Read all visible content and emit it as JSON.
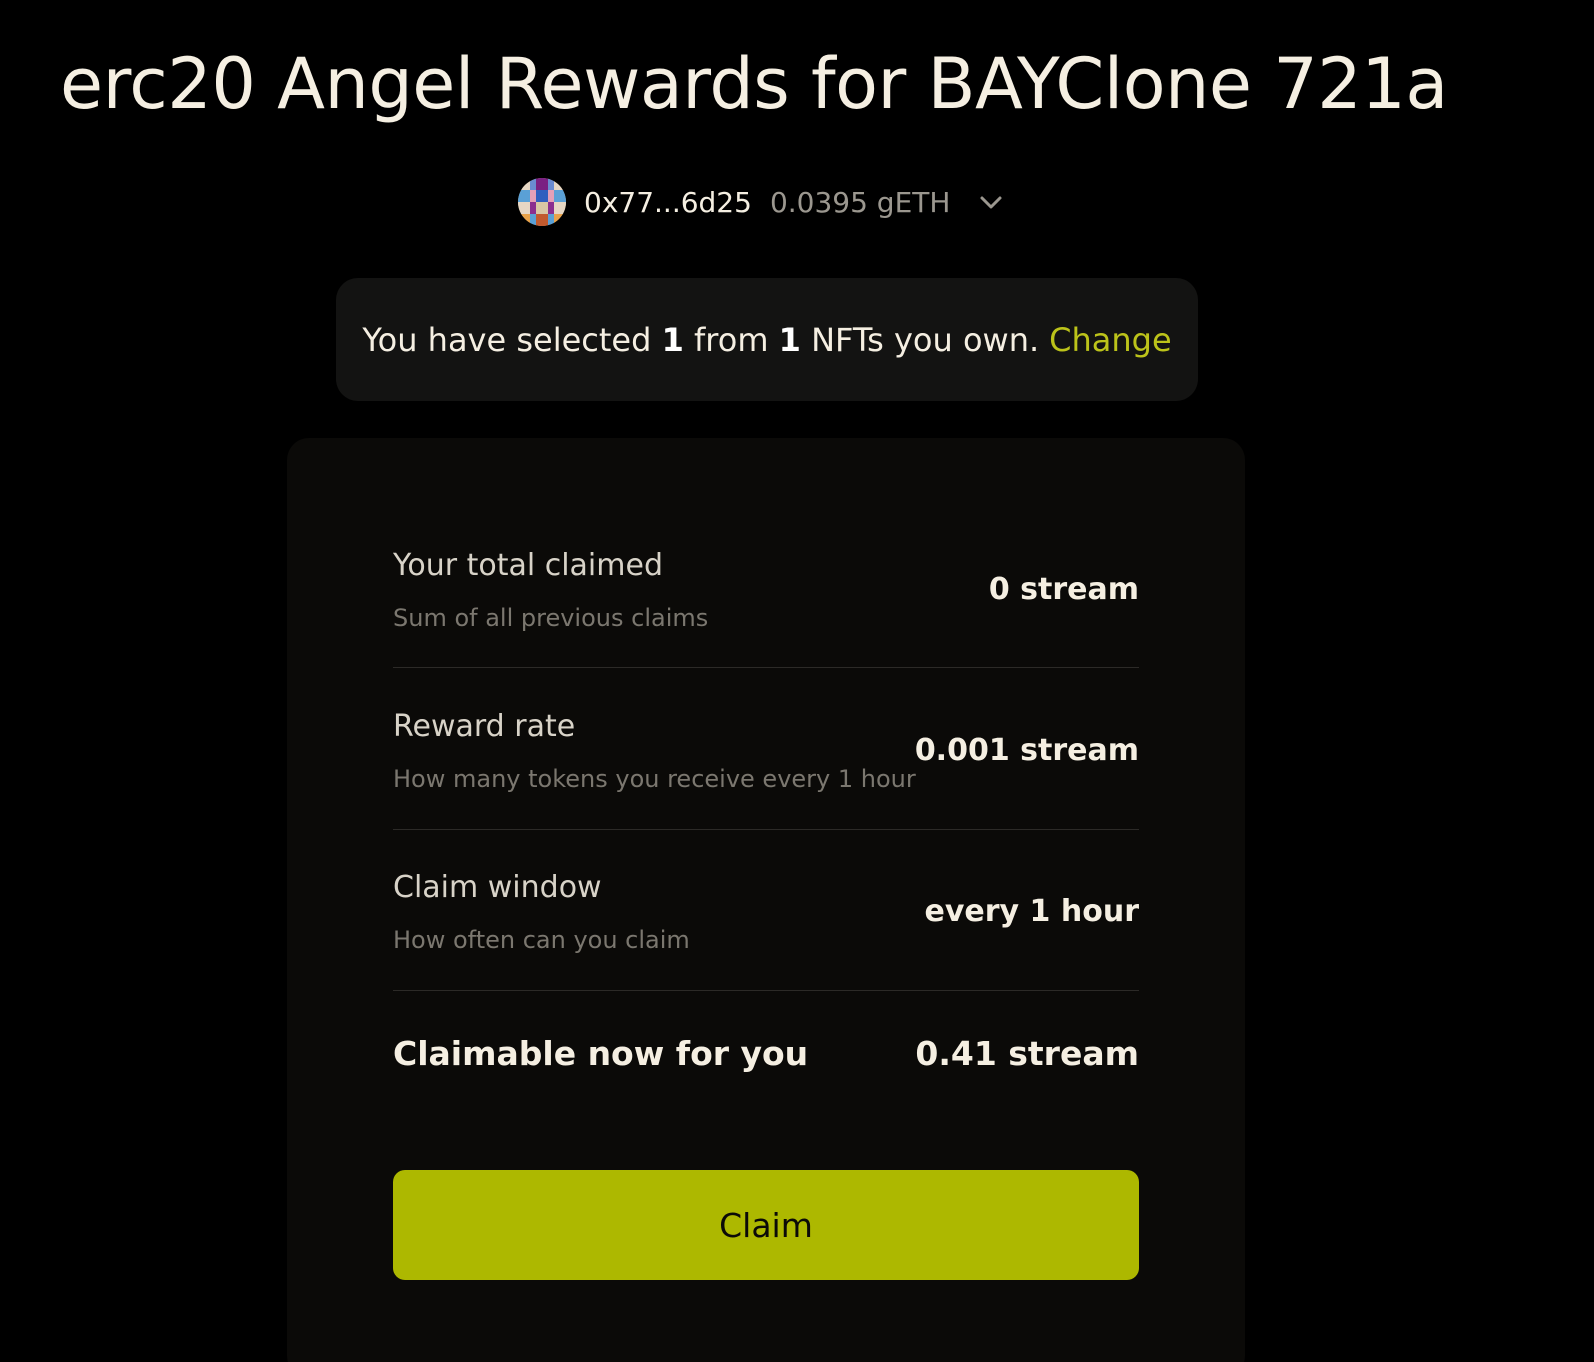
{
  "header": {
    "title": "erc20 Angel Rewards for BAYClone 721a"
  },
  "wallet": {
    "avatar_icon": "pixel-avatar-icon",
    "address": "0x77...6d25",
    "balance": "0.0395 gETH",
    "menu_icon": "chevron-down-icon"
  },
  "selection": {
    "prefix": "You have selected",
    "selected_count": "1",
    "middle": "from",
    "owned_count": "1",
    "suffix": "NFTs you own.",
    "change_label": "Change",
    "accent_color": "#bcc31a"
  },
  "stats": {
    "total_claimed": {
      "label": "Your total claimed",
      "description": "Sum of all previous claims",
      "value": "0 stream"
    },
    "reward_rate": {
      "label": "Reward rate",
      "description": "How many tokens you receive every 1 hour",
      "value": "0.001 stream"
    },
    "claim_window": {
      "label": "Claim window",
      "description": "How often can you claim",
      "value": "every 1 hour"
    },
    "claimable_now": {
      "label": "Claimable now for you",
      "value": "0.41 stream"
    }
  },
  "actions": {
    "claim_label": "Claim",
    "claim_color": "#adb800"
  }
}
